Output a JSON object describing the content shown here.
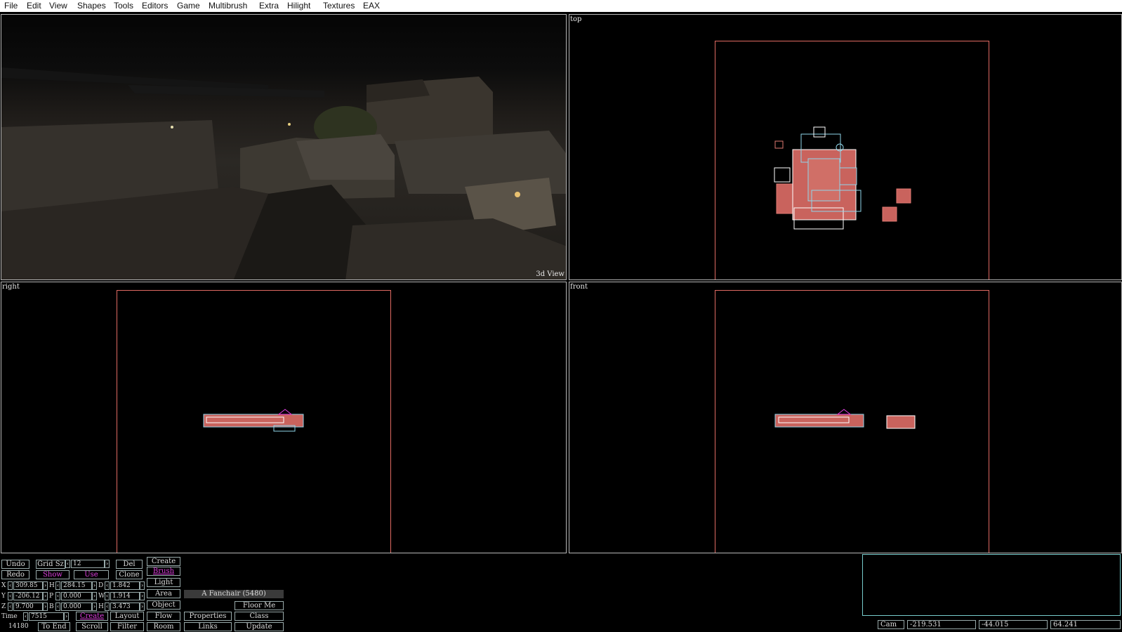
{
  "menu": [
    "File",
    "Edit",
    "View",
    "Shapes",
    "Tools",
    "Editors",
    "Game",
    "Multibrush",
    "Extra",
    "Hilight",
    "Textures",
    "EAX"
  ],
  "viewports": {
    "perspective_label": "3d View",
    "top_label": "top",
    "right_label": "right",
    "front_label": "front"
  },
  "colors": {
    "bounds": "#e06a62",
    "brush_red": "#e07a72",
    "brush_cyan": "#8fd6ea",
    "brush_white": "#ffffff"
  },
  "toolbar": {
    "undo": "Undo",
    "redo": "Redo",
    "grid_sz": "Grid Sz",
    "grid_value": "12",
    "show": "Show",
    "use": "Use",
    "del": "Del",
    "clone": "Clone",
    "create_header": "Create",
    "brush": "Brush",
    "light": "Light",
    "area": "Area",
    "object": "Object",
    "flow": "Flow",
    "room": "Room",
    "x_label": "X",
    "x_value": "309.85",
    "y_label": "Y",
    "y_value": "-206.12",
    "z_label": "Z",
    "z_value": "9.700",
    "h_label": "H",
    "h_value": "284.15",
    "p_label": "P",
    "p_value": "0.000",
    "b_label": "B",
    "b_value": "0.000",
    "d_label": "D",
    "d_value": "1.842",
    "w_label": "W",
    "w_value": "1.914",
    "h2_label": "H",
    "h2_value": "3.473",
    "selected_object": "A Fanchair (5480)",
    "floor_me": "Floor Me",
    "time_label": "Time",
    "time_value": "7515",
    "create": "Create",
    "layout": "Layout",
    "properties": "Properties",
    "class": "Class",
    "counter": "14180",
    "to_end": "To End",
    "scroll": "Scroll",
    "filter": "Filter",
    "links": "Links",
    "update": "Update"
  },
  "camera": {
    "label": "Cam",
    "x": "-219.531",
    "y": "-44.015",
    "z": "64.241"
  }
}
